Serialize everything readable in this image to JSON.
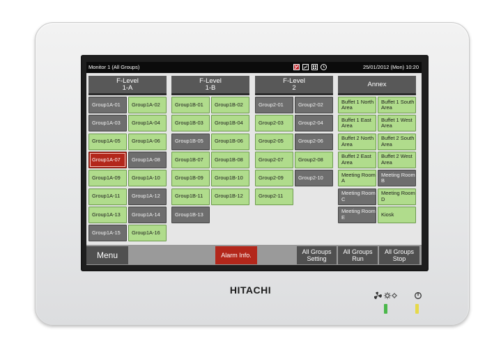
{
  "brand": "HITACHI",
  "header": {
    "title": "Monitor 1 (All Groups)",
    "datetime": "25/01/2012 (Mon) 10:20"
  },
  "header_icons": [
    "alarm-icon",
    "chart-icon",
    "grid-icon",
    "clock-icon"
  ],
  "columns": [
    {
      "line1": "F-Level",
      "line2": "1-A",
      "groups": [
        {
          "label": "Group1A-01",
          "state": "off"
        },
        {
          "label": "Group1A-02",
          "state": "on"
        },
        {
          "label": "Group1A-03",
          "state": "off"
        },
        {
          "label": "Group1A-04",
          "state": "on"
        },
        {
          "label": "Group1A-05",
          "state": "on"
        },
        {
          "label": "Group1A-06",
          "state": "on"
        },
        {
          "label": "Group1A-07",
          "state": "alarm"
        },
        {
          "label": "Group1A-08",
          "state": "off"
        },
        {
          "label": "Group1A-09",
          "state": "on"
        },
        {
          "label": "Group1A-10",
          "state": "on"
        },
        {
          "label": "Group1A-11",
          "state": "on"
        },
        {
          "label": "Group1A-12",
          "state": "off"
        },
        {
          "label": "Group1A-13",
          "state": "on"
        },
        {
          "label": "Group1A-14",
          "state": "off"
        },
        {
          "label": "Group1A-15",
          "state": "off"
        },
        {
          "label": "Group1A-16",
          "state": "on"
        }
      ]
    },
    {
      "line1": "F-Level",
      "line2": "1-B",
      "groups": [
        {
          "label": "Group1B-01",
          "state": "on"
        },
        {
          "label": "Group1B-02",
          "state": "on"
        },
        {
          "label": "Group1B-03",
          "state": "on"
        },
        {
          "label": "Group1B-04",
          "state": "on"
        },
        {
          "label": "Group1B-05",
          "state": "off"
        },
        {
          "label": "Group1B-06",
          "state": "on"
        },
        {
          "label": "Group1B-07",
          "state": "on"
        },
        {
          "label": "Group1B-08",
          "state": "on"
        },
        {
          "label": "Group1B-09",
          "state": "on"
        },
        {
          "label": "Group1B-10",
          "state": "on"
        },
        {
          "label": "Group1B-11",
          "state": "on"
        },
        {
          "label": "Group1B-12",
          "state": "on"
        },
        {
          "label": "Group1B-13",
          "state": "off"
        }
      ]
    },
    {
      "line1": "F-Level",
      "line2": "2",
      "groups": [
        {
          "label": "Group2-01",
          "state": "off"
        },
        {
          "label": "Group2-02",
          "state": "off"
        },
        {
          "label": "Group2-03",
          "state": "on"
        },
        {
          "label": "Group2-04",
          "state": "off"
        },
        {
          "label": "Group2-05",
          "state": "on"
        },
        {
          "label": "Group2-06",
          "state": "off"
        },
        {
          "label": "Group2-07",
          "state": "on"
        },
        {
          "label": "Group2-08",
          "state": "on"
        },
        {
          "label": "Group2-09",
          "state": "on"
        },
        {
          "label": "Group2-10",
          "state": "off"
        },
        {
          "label": "Group2-11",
          "state": "on"
        }
      ]
    },
    {
      "line1": "Annex",
      "line2": "",
      "groups": [
        {
          "label": "Buffet 1 North Area",
          "state": "on"
        },
        {
          "label": "Buffet 1 South Area",
          "state": "on"
        },
        {
          "label": "Buffet 1 East Area",
          "state": "on"
        },
        {
          "label": "Buffet 1 West Area",
          "state": "on"
        },
        {
          "label": "Buffet 2 North Area",
          "state": "on"
        },
        {
          "label": "Buffet 2 South Area",
          "state": "on"
        },
        {
          "label": "Buffet 2 East Area",
          "state": "on"
        },
        {
          "label": "Buffet 2 West Area",
          "state": "on"
        },
        {
          "label": "Meeting Room A",
          "state": "on"
        },
        {
          "label": "Meeting Room B",
          "state": "off"
        },
        {
          "label": "Meeting Room C",
          "state": "off"
        },
        {
          "label": "Meeting Room D",
          "state": "on"
        },
        {
          "label": "Meeting Room E",
          "state": "off"
        },
        {
          "label": "Kiosk",
          "state": "on"
        }
      ]
    }
  ],
  "bottom": {
    "menu": "Menu",
    "alarm": "Alarm Info.",
    "setting": [
      "All Groups",
      "Setting"
    ],
    "run": [
      "All Groups",
      "Run"
    ],
    "stop": [
      "All Groups",
      "Stop"
    ]
  },
  "colors": {
    "on": "#b0dc8c",
    "off": "#6e6e6e",
    "alarm": "#b3271b",
    "led_green": "#4bb84b",
    "led_yellow": "#e6d94a"
  }
}
